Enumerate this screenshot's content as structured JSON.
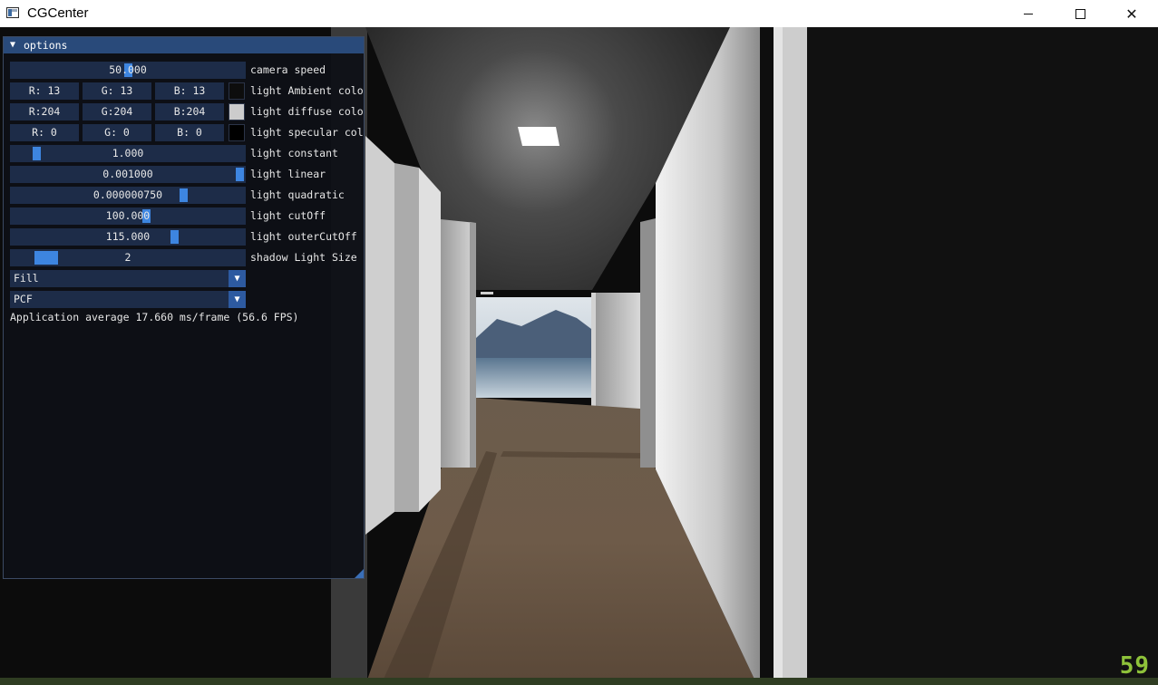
{
  "window": {
    "title": "CGCenter",
    "minimize_icon": "minimize-icon",
    "maximize_icon": "maximize-icon",
    "close_label": "✕"
  },
  "panel": {
    "title": "options",
    "collapse_glyph": "▼",
    "camera_speed": {
      "value": "50.000",
      "label": "camera speed"
    },
    "ambient": {
      "r": "R: 13",
      "g": "G: 13",
      "b": "B: 13",
      "color": "#0d0d0d",
      "label": "light Ambient colo"
    },
    "diffuse": {
      "r": "R:204",
      "g": "G:204",
      "b": "B:204",
      "color": "#cccccc",
      "label": "light diffuse colo"
    },
    "specular": {
      "r": "R:  0",
      "g": "G:  0",
      "b": "B:  0",
      "color": "#000000",
      "label": "light specular col"
    },
    "light_constant": {
      "value": "1.000",
      "label": "light constant"
    },
    "light_linear": {
      "value": "0.001000",
      "label": "light linear"
    },
    "light_quadratic": {
      "value": "0.000000750",
      "label": "light quadratic"
    },
    "light_cutoff": {
      "value": "100.000",
      "label": "light cutOff"
    },
    "light_outer_cutoff": {
      "value": "115.000",
      "label": "light outerCutOff"
    },
    "shadow_light_size": {
      "value": "2",
      "label": "shadow Light Size"
    },
    "polygon_mode": {
      "selected": "Fill",
      "arrow": "▼"
    },
    "shadow_mode": {
      "selected": "PCF",
      "arrow": "▼"
    },
    "stats": "Application average 17.660 ms/frame (56.6 FPS)"
  },
  "fps_counter": "59",
  "colors": {
    "panel_bg": "#0e1016",
    "header": "#294a7a",
    "frame_bg": "#1d2c48",
    "grab": "#3d85e0",
    "fps": "#8ec23a"
  }
}
